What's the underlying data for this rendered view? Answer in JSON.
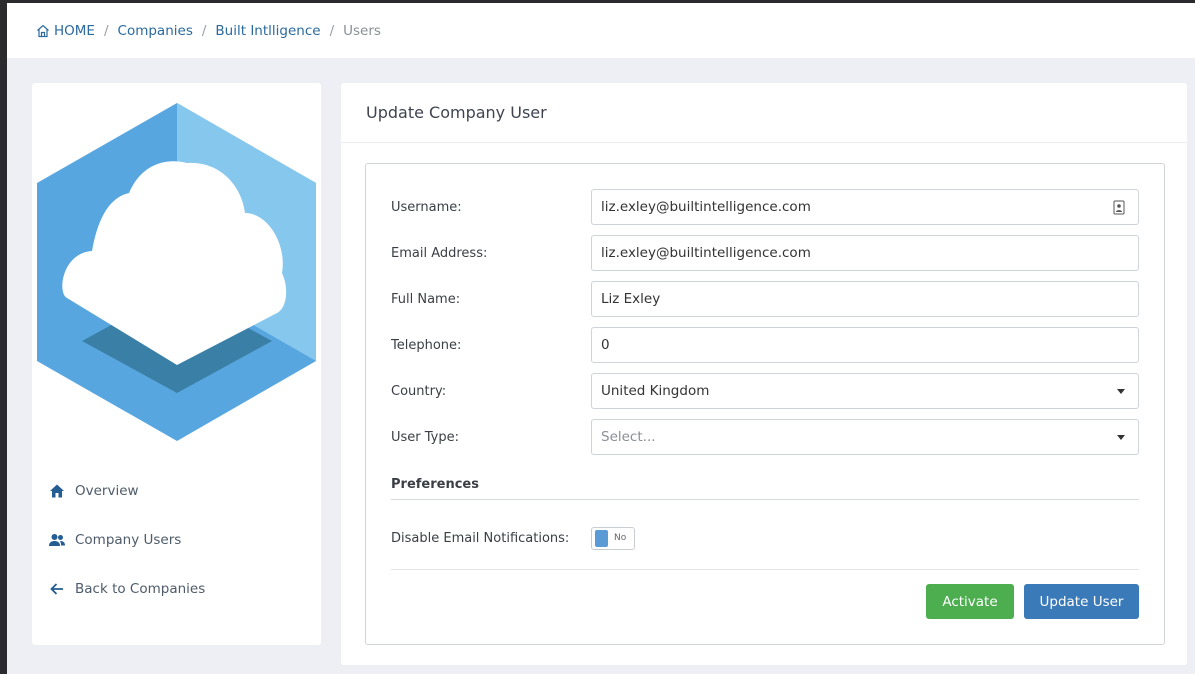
{
  "breadcrumb": {
    "home": "HOME",
    "companies": "Companies",
    "company": "Built Intlligence",
    "current": "Users"
  },
  "sidebar": {
    "items": [
      {
        "label": "Overview",
        "icon": "home-icon"
      },
      {
        "label": "Company Users",
        "icon": "users-icon"
      },
      {
        "label": "Back to Companies",
        "icon": "arrow-left-icon"
      }
    ]
  },
  "form": {
    "title": "Update Company User",
    "username": {
      "label": "Username:",
      "value": "liz.exley@builtintelligence.com"
    },
    "email": {
      "label": "Email Address:",
      "value": "liz.exley@builtintelligence.com"
    },
    "full_name": {
      "label": "Full Name:",
      "value": "Liz Exley"
    },
    "telephone": {
      "label": "Telephone:",
      "value": "0"
    },
    "country": {
      "label": "Country:",
      "value": "United Kingdom"
    },
    "user_type": {
      "label": "User Type:",
      "placeholder": "Select..."
    },
    "preferences_title": "Preferences",
    "disable_email": {
      "label": "Disable Email Notifications:",
      "toggle_text": "No"
    },
    "activate_label": "Activate",
    "update_label": "Update User"
  },
  "colors": {
    "accent": "#2b6a9e",
    "activate": "#4cae4f",
    "update": "#3a7ab8"
  }
}
